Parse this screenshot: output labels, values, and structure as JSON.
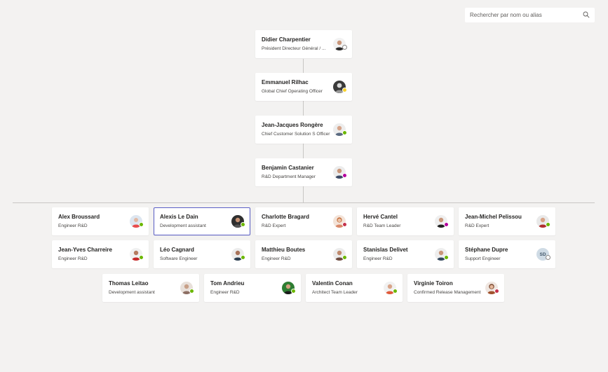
{
  "search": {
    "placeholder": "Rechercher par nom ou alias"
  },
  "colors": {
    "background": "#f3f2f1",
    "available": "#6bb700",
    "away": "#f8d22a",
    "busy": "#c4314b",
    "do_not_disturb": "#c4314b",
    "out_of_office": "#b4009e",
    "offline": "#8a8886",
    "selection": "#5b5fc7"
  },
  "managers": [
    {
      "name": "Didier Charpentier",
      "title": "Président Directeur Général / ...",
      "status": "offline",
      "avatar": "photo"
    },
    {
      "name": "Emmanuel Rilhac",
      "title": "Global Chief Operating Officer",
      "status": "away",
      "avatar": "photo"
    },
    {
      "name": "Jean-Jacques Rongère",
      "title": "Chief Customer Solution S Officer",
      "status": "available",
      "avatar": "photo"
    },
    {
      "name": "Benjamin Castanier",
      "title": "R&D Department Manager",
      "status": "out_of_office",
      "avatar": "photo"
    }
  ],
  "reports": [
    {
      "name": "Alex Broussard",
      "title": "Engineer R&D",
      "status": "available",
      "avatar": "photo"
    },
    {
      "name": "Alexis Le Dain",
      "title": "Development assistant",
      "status": "available",
      "avatar": "photo",
      "selected": true
    },
    {
      "name": "Charlotte Bragard",
      "title": "R&D Expert",
      "status": "do_not_disturb",
      "avatar": "photo"
    },
    {
      "name": "Hervé Cantel",
      "title": "R&D Team Leader",
      "status": "out_of_office",
      "avatar": "photo"
    },
    {
      "name": "Jean-Michel Pelissou",
      "title": "R&D Expert",
      "status": "available",
      "avatar": "photo"
    },
    {
      "name": "Jean-Yves Charreire",
      "title": "Engineer R&D",
      "status": "available",
      "avatar": "photo"
    },
    {
      "name": "Léo Cagnard",
      "title": "Software Engineer",
      "status": "available",
      "avatar": "photo"
    },
    {
      "name": "Matthieu Boutes",
      "title": "Engineer R&D",
      "status": "available",
      "avatar": "photo"
    },
    {
      "name": "Stanislas Delivet",
      "title": "Engineer R&D",
      "status": "available",
      "avatar": "photo"
    },
    {
      "name": "Stéphane Dupre",
      "title": "Support Engineer",
      "status": "offline",
      "avatar": "initials",
      "initials": "SD"
    },
    {
      "name": "Thomas Leitao",
      "title": "Development assistant",
      "status": "available",
      "avatar": "photo"
    },
    {
      "name": "Tom Andrieu",
      "title": "Engineer R&D",
      "status": "available",
      "avatar": "photo"
    },
    {
      "name": "Valentin Conan",
      "title": "Architect Team Leader",
      "status": "available",
      "avatar": "photo"
    },
    {
      "name": "Virginie Toiron",
      "title": "Confirmed Release Management",
      "status": "busy",
      "avatar": "photo"
    }
  ]
}
